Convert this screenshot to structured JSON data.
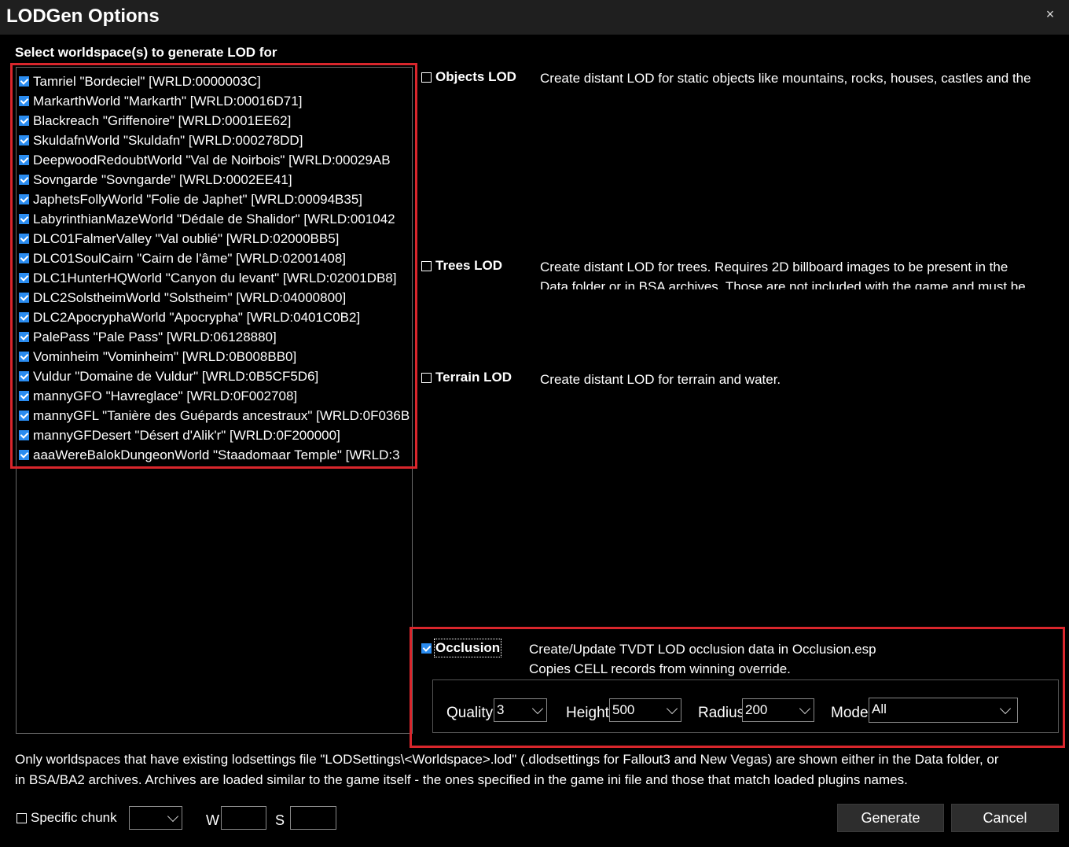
{
  "window": {
    "title": "LODGen Options",
    "close_glyph": "×"
  },
  "worldspaces": {
    "label": "Select worldspace(s) to generate LOD for",
    "items": [
      {
        "text": "Tamriel \"Bordeciel\" [WRLD:0000003C]",
        "checked": true
      },
      {
        "text": "MarkarthWorld \"Markarth\" [WRLD:00016D71]",
        "checked": true
      },
      {
        "text": "Blackreach \"Griffenoire\" [WRLD:0001EE62]",
        "checked": true
      },
      {
        "text": "SkuldafnWorld \"Skuldafn\" [WRLD:000278DD]",
        "checked": true
      },
      {
        "text": "DeepwoodRedoubtWorld \"Val de Noirbois\" [WRLD:00029AB",
        "checked": true
      },
      {
        "text": "Sovngarde \"Sovngarde\" [WRLD:0002EE41]",
        "checked": true
      },
      {
        "text": "JaphetsFollyWorld \"Folie de Japhet\" [WRLD:00094B35]",
        "checked": true
      },
      {
        "text": "LabyrinthianMazeWorld \"Dédale de Shalidor\" [WRLD:001042",
        "checked": true
      },
      {
        "text": "DLC01FalmerValley \"Val oublié\" [WRLD:02000BB5]",
        "checked": true
      },
      {
        "text": "DLC01SoulCairn \"Cairn de l'âme\" [WRLD:02001408]",
        "checked": true
      },
      {
        "text": "DLC1HunterHQWorld \"Canyon du levant\" [WRLD:02001DB8]",
        "checked": true
      },
      {
        "text": "DLC2SolstheimWorld \"Solstheim\" [WRLD:04000800]",
        "checked": true
      },
      {
        "text": "DLC2ApocryphaWorld \"Apocrypha\" [WRLD:0401C0B2]",
        "checked": true
      },
      {
        "text": "PalePass \"Pale Pass\" [WRLD:06128880]",
        "checked": true
      },
      {
        "text": "Vominheim \"Vominheim\" [WRLD:0B008BB0]",
        "checked": true
      },
      {
        "text": "Vuldur \"Domaine de Vuldur\" [WRLD:0B5CF5D6]",
        "checked": true
      },
      {
        "text": "mannyGFO \"Havreglace\" [WRLD:0F002708]",
        "checked": true
      },
      {
        "text": "mannyGFL \"Tanière des Guépards ancestraux\" [WRLD:0F036B",
        "checked": true
      },
      {
        "text": "mannyGFDesert \"Désert d'Alik'r\" [WRLD:0F200000]",
        "checked": true
      },
      {
        "text": "aaaWereBalokDungeonWorld \"Staadomaar Temple\" [WRLD:3",
        "checked": true
      }
    ]
  },
  "options": {
    "objects": {
      "label": "Objects LOD",
      "checked": false,
      "desc": "Create distant LOD for static objects like mountains, rocks, houses, castles and the"
    },
    "trees": {
      "label": "Trees LOD",
      "checked": false,
      "desc1": "Create distant LOD for trees. Requires 2D billboard images to be present in the",
      "desc2": "Data folder or in BSA archives. Those are not included with the game and must be"
    },
    "terrain": {
      "label": "Terrain LOD",
      "checked": false,
      "desc": "Create distant LOD for terrain and water."
    },
    "occlusion": {
      "label": "Occlusion",
      "checked": true,
      "desc1": "Create/Update TVDT LOD occlusion data in Occlusion.esp",
      "desc2": "Copies CELL records from winning override.",
      "quality_label": "Quality",
      "quality_value": "3",
      "height_label": "Height",
      "height_value": "500",
      "radius_label": "Radius",
      "radius_value": "200",
      "mode_label": "Mode",
      "mode_value": "All"
    }
  },
  "info": {
    "line1": "Only worldspaces that have existing lodsettings file \"LODSettings\\<Worldspace>.lod\" (.dlodsettings for Fallout3 and New Vegas) are shown either in the Data folder, or",
    "line2": "in BSA/BA2 archives. Archives are loaded similar to the game itself - the ones specified in the game ini file and those that match loaded plugins names."
  },
  "chunk": {
    "label": "Specific chunk",
    "checked": false,
    "w_label": "W",
    "s_label": "S"
  },
  "buttons": {
    "generate": "Generate",
    "cancel": "Cancel"
  },
  "colors": {
    "highlight": "#d9262c",
    "accent": "#2a8cf0",
    "button": "#2d2d2d"
  }
}
